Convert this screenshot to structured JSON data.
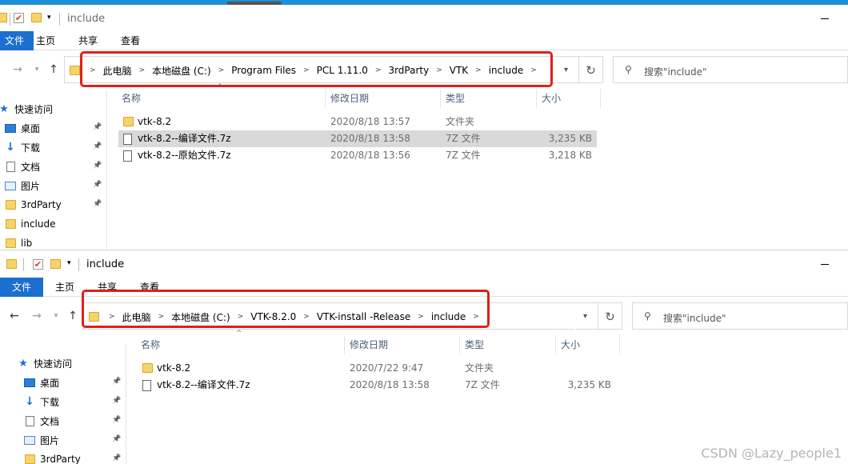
{
  "win1": {
    "title": "include",
    "tabs": [
      "文件",
      "主页",
      "共享",
      "查看"
    ],
    "breadcrumb": [
      "此电脑",
      "本地磁盘 (C:)",
      "Program Files",
      "PCL 1.11.0",
      "3rdParty",
      "VTK",
      "include"
    ],
    "search_placeholder": "搜索\"include\"",
    "columns": [
      "名称",
      "修改日期",
      "类型",
      "大小"
    ],
    "files": [
      {
        "name": "vtk-8.2",
        "date": "2020/8/18 13:57",
        "type": "文件夹",
        "size": "",
        "kind": "folder"
      },
      {
        "name": "vtk-8.2--编译文件.7z",
        "date": "2020/8/18 13:58",
        "type": "7Z 文件",
        "size": "3,235 KB",
        "kind": "file"
      },
      {
        "name": "vtk-8.2--原始文件.7z",
        "date": "2020/8/18 13:56",
        "type": "7Z 文件",
        "size": "3,218 KB",
        "kind": "file"
      }
    ],
    "sidebar": [
      {
        "label": "快速访问",
        "icon": "star-icon",
        "pinned": false
      },
      {
        "label": "桌面",
        "icon": "desktop-icon",
        "pinned": true
      },
      {
        "label": "下载",
        "icon": "download-icon",
        "pinned": true
      },
      {
        "label": "文档",
        "icon": "document-icon",
        "pinned": true
      },
      {
        "label": "图片",
        "icon": "pictures-icon",
        "pinned": true
      },
      {
        "label": "3rdParty",
        "icon": "folder-icon",
        "pinned": true
      },
      {
        "label": "include",
        "icon": "folder-icon",
        "pinned": false
      },
      {
        "label": "lib",
        "icon": "folder-icon",
        "pinned": false
      }
    ]
  },
  "win2": {
    "title": "include",
    "tabs": [
      "文件",
      "主页",
      "共享",
      "查看"
    ],
    "breadcrumb": [
      "此电脑",
      "本地磁盘 (C:)",
      "VTK-8.2.0",
      "VTK-install -Release",
      "include"
    ],
    "search_placeholder": "搜索\"include\"",
    "columns": [
      "名称",
      "修改日期",
      "类型",
      "大小"
    ],
    "files": [
      {
        "name": "vtk-8.2",
        "date": "2020/7/22 9:47",
        "type": "文件夹",
        "size": "",
        "kind": "folder"
      },
      {
        "name": "vtk-8.2--编译文件.7z",
        "date": "2020/8/18 13:58",
        "type": "7Z 文件",
        "size": "3,235 KB",
        "kind": "file"
      }
    ],
    "sidebar": [
      {
        "label": "快速访问",
        "icon": "star-icon",
        "pinned": false
      },
      {
        "label": "桌面",
        "icon": "desktop-icon",
        "pinned": true
      },
      {
        "label": "下载",
        "icon": "download-icon",
        "pinned": true
      },
      {
        "label": "文档",
        "icon": "document-icon",
        "pinned": true
      },
      {
        "label": "图片",
        "icon": "pictures-icon",
        "pinned": true
      },
      {
        "label": "3rdParty",
        "icon": "folder-icon",
        "pinned": true
      }
    ]
  },
  "watermark": "CSDN @Lazy_people1",
  "colors": {
    "accent": "#1b6fd1",
    "highlight": "#e0201a",
    "selected_row": "#d9d9d9"
  }
}
